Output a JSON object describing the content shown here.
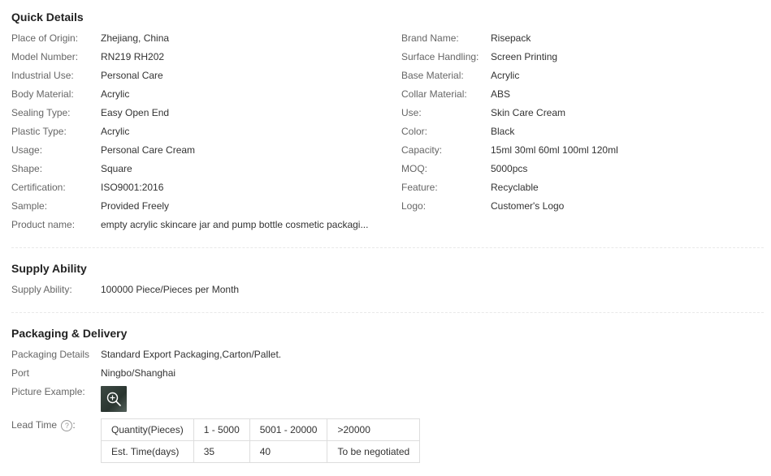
{
  "quick_details": {
    "title": "Quick Details",
    "left": [
      {
        "label": "Place of Origin:",
        "value": "Zhejiang, China"
      },
      {
        "label": "Model Number:",
        "value": "RN219 RH202"
      },
      {
        "label": "Industrial Use:",
        "value": "Personal Care"
      },
      {
        "label": "Body Material:",
        "value": "Acrylic"
      },
      {
        "label": "Sealing Type:",
        "value": "Easy Open End"
      },
      {
        "label": "Plastic Type:",
        "value": "Acrylic"
      },
      {
        "label": "Usage:",
        "value": "Personal Care Cream"
      },
      {
        "label": "Shape:",
        "value": "Square"
      },
      {
        "label": "Certification:",
        "value": "ISO9001:2016"
      },
      {
        "label": "Sample:",
        "value": "Provided Freely"
      },
      {
        "label": "Product name:",
        "value": "empty acrylic skincare jar and pump bottle cosmetic packagi..."
      }
    ],
    "right": [
      {
        "label": "Brand Name:",
        "value": "Risepack"
      },
      {
        "label": "Surface Handling:",
        "value": "Screen Printing"
      },
      {
        "label": "Base Material:",
        "value": "Acrylic"
      },
      {
        "label": "Collar Material:",
        "value": "ABS"
      },
      {
        "label": "Use:",
        "value": "Skin Care Cream"
      },
      {
        "label": "Color:",
        "value": "Black"
      },
      {
        "label": "Capacity:",
        "value": "15ml 30ml 60ml 100ml 120ml"
      },
      {
        "label": "MOQ:",
        "value": "5000pcs"
      },
      {
        "label": "Feature:",
        "value": "Recyclable"
      },
      {
        "label": "Logo:",
        "value": "Customer's Logo"
      }
    ]
  },
  "supply_ability": {
    "title": "Supply Ability",
    "label": "Supply Ability:",
    "value": "100000 Piece/Pieces per Month"
  },
  "packaging": {
    "title": "Packaging & Delivery",
    "details_label": "Packaging Details",
    "details_value": "Standard Export Packaging,Carton/Pallet.",
    "port_label": "Port",
    "port_value": "Ningbo/Shanghai",
    "picture_label": "Picture Example:",
    "picture_icon": "zoom-in-icon",
    "lead_time_label": "Lead Time",
    "help_icon": "?",
    "lead_time_table": {
      "header": [
        "Quantity(Pieces)",
        "1 - 5000",
        "5001 - 20000",
        ">20000"
      ],
      "row": [
        "Est. Time(days)",
        "35",
        "40",
        "To be negotiated"
      ]
    }
  }
}
